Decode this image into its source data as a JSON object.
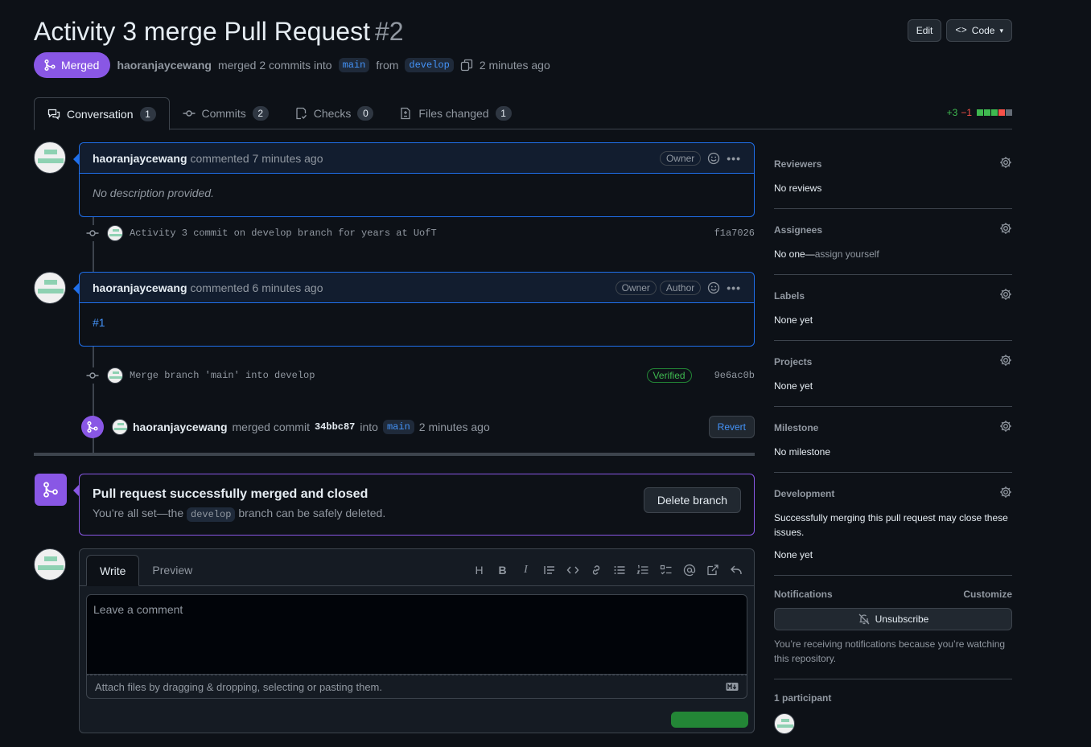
{
  "header": {
    "title": "Activity 3 merge Pull Request",
    "number": "#2",
    "edit_label": "Edit",
    "code_label": "Code",
    "state": "Merged",
    "author": "haoranjaycewang",
    "merged_text": "merged 2 commits into",
    "base_branch": "main",
    "from_text": "from",
    "head_branch": "develop",
    "time": "2 minutes ago"
  },
  "tabs": [
    {
      "label": "Conversation",
      "count": "1"
    },
    {
      "label": "Commits",
      "count": "2"
    },
    {
      "label": "Checks",
      "count": "0"
    },
    {
      "label": "Files changed",
      "count": "1"
    }
  ],
  "diffstat": {
    "additions": "+3",
    "deletions": "−1",
    "colors": [
      "#3fb950",
      "#3fb950",
      "#3fb950",
      "#f85149",
      "#656c76"
    ]
  },
  "comment1": {
    "author": "haoranjaycewang",
    "action": "commented 7 minutes ago",
    "badge_owner": "Owner",
    "body": "No description provided."
  },
  "commit1": {
    "message": "Activity 3 commit on develop branch for years at UofT",
    "sha": "f1a7026"
  },
  "comment2": {
    "author": "haoranjaycewang",
    "action": "commented 6 minutes ago",
    "badge_owner": "Owner",
    "badge_author": "Author",
    "body": "#1"
  },
  "commit2": {
    "message": "Merge branch 'main' into develop",
    "verified": "Verified",
    "sha": "9e6ac0b"
  },
  "merge_event": {
    "author": "haoranjaycewang",
    "text": "merged commit",
    "sha": "34bbc87",
    "into": "into",
    "branch": "main",
    "time": "2 minutes ago",
    "revert_label": "Revert"
  },
  "merged_box": {
    "title": "Pull request successfully merged and closed",
    "sub_prefix": "You’re all set—the",
    "branch": "develop",
    "sub_suffix": "branch can be safely deleted.",
    "delete_label": "Delete branch"
  },
  "editor": {
    "write_tab": "Write",
    "preview_tab": "Preview",
    "placeholder": "Leave a comment",
    "attach_text": "Attach files by dragging & dropping, selecting or pasting them.",
    "toolbar_icons": [
      "heading-icon",
      "bold-icon",
      "italic-icon",
      "quote-icon",
      "code-icon",
      "link-icon",
      "unordered-list-icon",
      "ordered-list-icon",
      "task-list-icon",
      "mention-icon",
      "reference-icon",
      "reply-icon"
    ]
  },
  "sidebar": {
    "reviewers": {
      "title": "Reviewers",
      "value": "No reviews"
    },
    "assignees": {
      "title": "Assignees",
      "value": "No one—",
      "link": "assign yourself"
    },
    "labels": {
      "title": "Labels",
      "value": "None yet"
    },
    "projects": {
      "title": "Projects",
      "value": "None yet"
    },
    "milestone": {
      "title": "Milestone",
      "value": "No milestone"
    },
    "development": {
      "title": "Development",
      "note": "Successfully merging this pull request may close these issues.",
      "value": "None yet"
    },
    "notifications": {
      "title": "Notifications",
      "customize": "Customize",
      "unsubscribe": "Unsubscribe",
      "note": "You’re receiving notifications because you’re watching this repository."
    },
    "participants": {
      "title": "1 participant"
    }
  },
  "colors": {
    "merged": "#8957e5",
    "accent": "#1f6feb",
    "link": "#4493f8",
    "success": "#238636"
  }
}
